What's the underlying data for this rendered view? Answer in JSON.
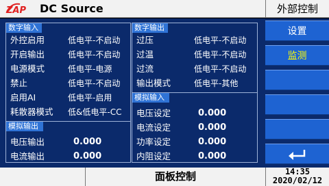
{
  "header": {
    "title": "DC Source",
    "mode": "外部控制"
  },
  "digital_input": {
    "title": "数字输入",
    "rows": [
      {
        "label": "外控启用",
        "value": "低电平-不启动"
      },
      {
        "label": "开启输出",
        "value": "低电平-不启动"
      },
      {
        "label": "电源模式",
        "value": "低电平-电源"
      },
      {
        "label": "禁止",
        "value": "低电平-不启动"
      },
      {
        "label": "启用AI",
        "value": "低电平-启用"
      },
      {
        "label": "耗散器模式",
        "value": "低&低电平-CC"
      }
    ]
  },
  "analog_output": {
    "title": "模拟输出",
    "rows": [
      {
        "label": "电压输出",
        "value": "0.000"
      },
      {
        "label": "电流输出",
        "value": "0.000"
      }
    ]
  },
  "digital_output": {
    "title": "数字输出",
    "rows": [
      {
        "label": "过压",
        "value": "低电平-不启动"
      },
      {
        "label": "过温",
        "value": "低电平-不启动"
      },
      {
        "label": "过流",
        "value": "低电平-不启动"
      },
      {
        "label": "输出模式",
        "value": "低电平-其他"
      }
    ]
  },
  "analog_input": {
    "title": "模拟输入",
    "rows": [
      {
        "label": "电压设定",
        "value": "0.000"
      },
      {
        "label": "电流设定",
        "value": "0.000"
      },
      {
        "label": "功率设定",
        "value": "0.000"
      },
      {
        "label": "内阻设定",
        "value": "0.000"
      }
    ]
  },
  "sidebar": {
    "settings_label": "设置",
    "monitor_label": "监测",
    "return_icon": "return-enter-icon",
    "active_color": "#ffff00"
  },
  "footer": {
    "panel_label": "面板控制",
    "time": "14:35",
    "date": "2020/02/12"
  },
  "colors": {
    "background": "#0b2a6b",
    "section_header": "#2f73d6",
    "button": "#1e63d2",
    "bar": "#f2f2f2"
  }
}
